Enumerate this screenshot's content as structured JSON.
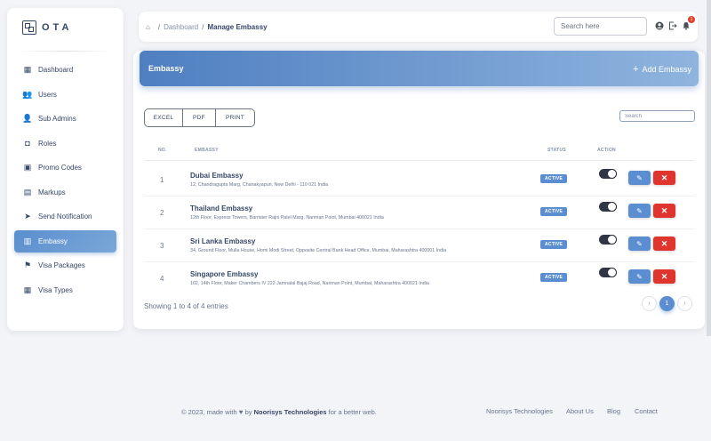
{
  "brand": {
    "name": "OTA"
  },
  "sidebar": {
    "items": [
      {
        "label": "Dashboard",
        "icon": "dashboard-icon",
        "glyph": "▦"
      },
      {
        "label": "Users",
        "icon": "users-icon",
        "glyph": "👥"
      },
      {
        "label": "Sub Admins",
        "icon": "sub-admins-icon",
        "glyph": "👤"
      },
      {
        "label": "Roles",
        "icon": "roles-icon",
        "glyph": "◘"
      },
      {
        "label": "Promo Codes",
        "icon": "promo-codes-icon",
        "glyph": "▣"
      },
      {
        "label": "Markups",
        "icon": "markups-icon",
        "glyph": "▤"
      },
      {
        "label": "Send Notification",
        "icon": "send-icon",
        "glyph": "➤"
      },
      {
        "label": "Embassy",
        "icon": "embassy-icon",
        "glyph": "▥"
      },
      {
        "label": "Visa Packages",
        "icon": "flag-icon",
        "glyph": "⚑"
      },
      {
        "label": "Visa Types",
        "icon": "visa-types-icon",
        "glyph": "▦"
      }
    ],
    "active_index": 7
  },
  "header": {
    "breadcrumb": {
      "parent": "Dashboard",
      "current": "Manage Embassy"
    },
    "search_placeholder": "Search here",
    "notification_count": "1"
  },
  "card": {
    "title": "Embassy",
    "add_label": "Add Embassy",
    "export_buttons": [
      "EXCEL",
      "PDF",
      "PRINT"
    ],
    "search_placeholder": "Search",
    "columns": {
      "no": "NO.",
      "embassy": "EMBASSY",
      "status": "STATUS",
      "action": "ACTION"
    },
    "rows": [
      {
        "no": "1",
        "name": "Dubai Embassy",
        "address": "12, Chandragupta Marg, Chanakyapuri, New Delhi - 110 021 India",
        "status": "ACTIVE"
      },
      {
        "no": "2",
        "name": "Thailand Embassy",
        "address": "12th Floor, Express Towers, Barrister Rajni Patel Marg, Nariman Point, Mumbai 400021 India",
        "status": "ACTIVE"
      },
      {
        "no": "3",
        "name": "Sri Lanka Embassy",
        "address": "34, Ground Floor, Mulla House, Homi Modi Street, Opposite Central Bank Head Office, Mumbai, Maharashtra 400001 India",
        "status": "ACTIVE"
      },
      {
        "no": "4",
        "name": "Singapore Embassy",
        "address": "102, 14th Floor, Maker Chambers IV 222 Jamnalal Bajaj Road, Nariman Point, Mumbai, Maharashtra 400021 India",
        "status": "ACTIVE"
      }
    ],
    "showing_text": "Showing 1 to 4 of 4 entries",
    "pagination": {
      "prev": "‹",
      "current": "1",
      "next": "›"
    }
  },
  "footer": {
    "prefix": "© 2023, made with",
    "by": "by",
    "company": "Noorisys Technologies",
    "suffix": "for a better web.",
    "links": [
      "Noorisys Technologies",
      "About Us",
      "Blog",
      "Contact"
    ]
  },
  "colors": {
    "accent": "#5b8ed0",
    "danger": "#e0342f",
    "text": "#344767"
  }
}
